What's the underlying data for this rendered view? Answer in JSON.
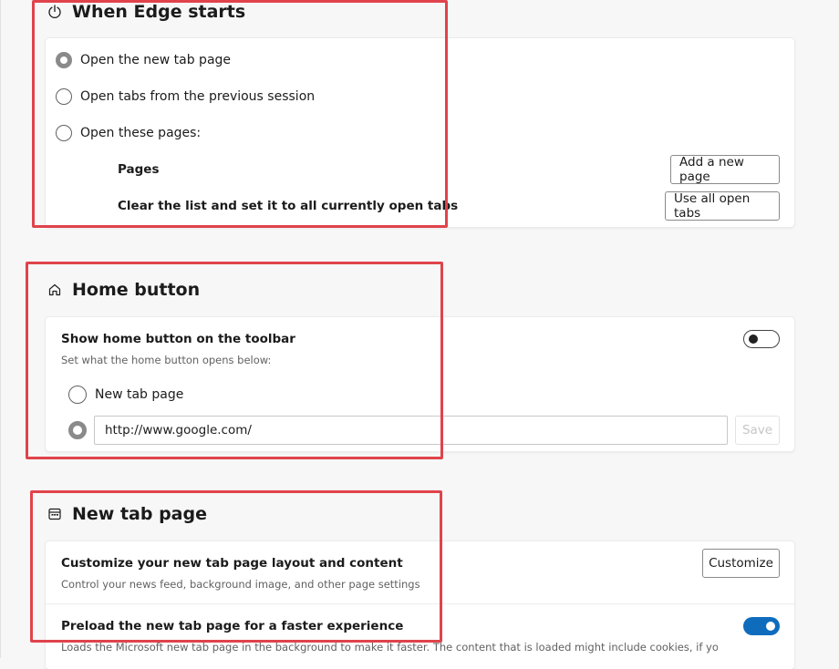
{
  "startup": {
    "title": "When Edge starts",
    "options": [
      {
        "label": "Open the new tab page",
        "selected": true
      },
      {
        "label": "Open tabs from the previous session",
        "selected": false
      },
      {
        "label": "Open these pages:",
        "selected": false
      }
    ],
    "pages_label": "Pages",
    "add_page_button": "Add a new page",
    "clear_label": "Clear the list and set it to all currently open tabs",
    "use_open_tabs_button": "Use all open tabs"
  },
  "home_button": {
    "title": "Home button",
    "show_label": "Show home button on the toolbar",
    "description": "Set what the home button opens below:",
    "toggle_on": false,
    "option_new_tab": "New tab page",
    "url_value": "http://www.google.com/",
    "save_button": "Save"
  },
  "new_tab_page": {
    "title": "New tab page",
    "customize_label": "Customize your new tab page layout and content",
    "customize_description": "Control your news feed, background image, and other page settings",
    "customize_button": "Customize",
    "preload_label": "Preload the new tab page for a faster experience",
    "preload_description": "Loads the Microsoft new tab page in the background to make it faster. The content that is loaded might include cookies, if you allow",
    "preload_toggle_on": true
  },
  "colors": {
    "accent": "#0f6cbd",
    "highlight": "#e0434b"
  },
  "icons": [
    "power-icon",
    "home-icon",
    "new-tab-page-icon"
  ]
}
